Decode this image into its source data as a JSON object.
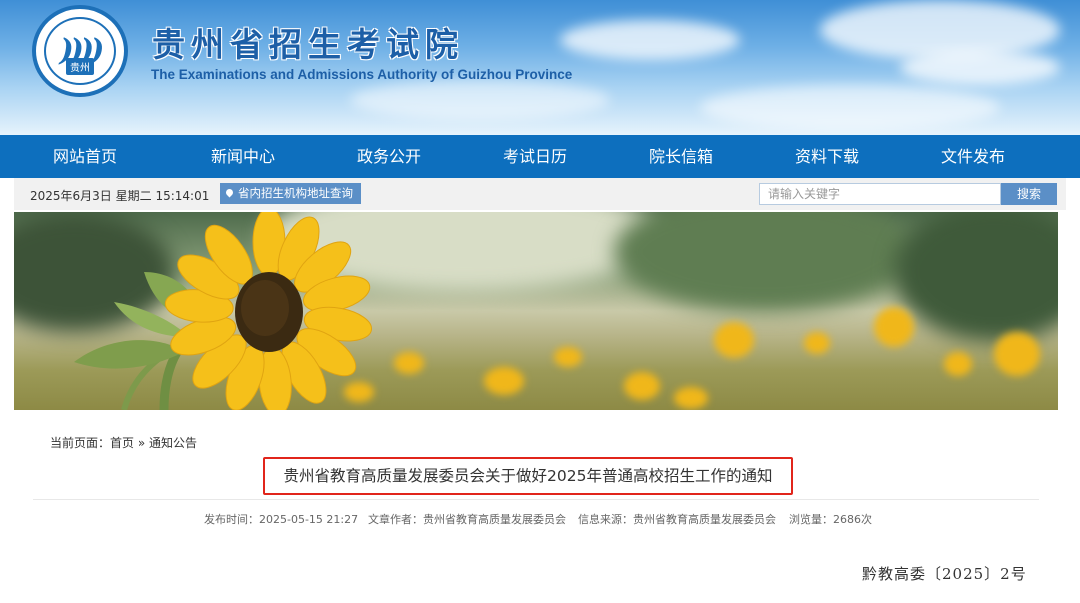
{
  "header": {
    "title_cn": "贵州省招生考试院",
    "title_en": "The Examinations and Admissions Authority of Guizhou Province",
    "logo_tag": "贵州"
  },
  "nav": {
    "items": [
      "网站首页",
      "新闻中心",
      "政务公开",
      "考试日历",
      "院长信箱",
      "资料下载",
      "文件发布"
    ]
  },
  "infobar": {
    "datetime": "2025年6月3日  星期二  15:14:01",
    "address_button": "省内招生机构地址查询",
    "search_placeholder": "请输入关键字",
    "search_button": "搜索"
  },
  "breadcrumb": {
    "prefix": "当前页面：",
    "home": "首页",
    "separator": "»",
    "current": "通知公告"
  },
  "article": {
    "title": "贵州省教育高质量发展委员会关于做好2025年普通高校招生工作的通知",
    "publish_time": "发布时间：2025-05-15 21:27",
    "author": "文章作者：贵州省教育高质量发展委员会",
    "source": "信息来源：贵州省教育高质量发展委员会",
    "views": "浏览量：2686次",
    "doc_number": "黔教高委〔2025〕2号"
  },
  "colors": {
    "nav_bg": "#0d6fbe",
    "highlight_border": "#e1251b",
    "brand_blue": "#1d5fa7"
  }
}
